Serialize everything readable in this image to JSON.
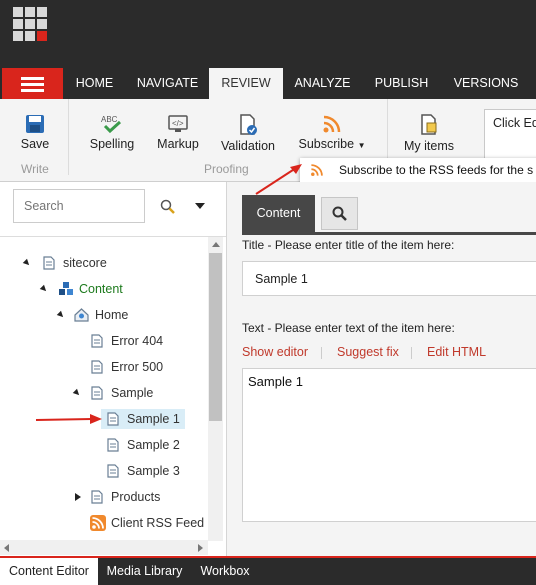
{
  "colors": {
    "accent_red": "#d9251c",
    "dark_bar": "#2b2b2b",
    "link_red": "#c0392b",
    "selected_bg": "#d9edf7"
  },
  "menu_icon": "hamburger-icon",
  "ribbon_tabs": [
    {
      "label": "HOME"
    },
    {
      "label": "NAVIGATE"
    },
    {
      "label": "REVIEW",
      "active": true
    },
    {
      "label": "ANALYZE"
    },
    {
      "label": "PUBLISH"
    },
    {
      "label": "VERSIONS"
    }
  ],
  "ribbon": {
    "write_group": {
      "save": "Save",
      "label": "Write"
    },
    "proofing_group": {
      "spelling": "Spelling",
      "markup": "Markup",
      "validation": "Validation",
      "subscribe": "Subscribe",
      "label": "Proofing"
    },
    "my_items": "My items",
    "click_box_text": "Click Ed"
  },
  "tooltip": {
    "text": "Subscribe to the RSS feeds for the s",
    "icon": "rss-icon"
  },
  "search": {
    "placeholder": "Search"
  },
  "tree": {
    "sitecore": "sitecore",
    "content": "Content",
    "home": "Home",
    "error404": "Error 404",
    "error500": "Error 500",
    "sample": "Sample",
    "sample1": "Sample 1",
    "sample2": "Sample 2",
    "sample3": "Sample 3",
    "products": "Products",
    "rss": "Client RSS Feed",
    "selected": "Sample 1"
  },
  "editor": {
    "content_tab": "Content",
    "title_label": "Title - Please enter title of the item here:",
    "title_value": "Sample 1",
    "text_label": "Text - Please enter text of the item here:",
    "links": {
      "show_editor": "Show editor",
      "suggest_fix": "Suggest fix",
      "edit_html": "Edit HTML"
    },
    "text_value": "Sample 1"
  },
  "bottom_tabs": [
    {
      "label": "Content Editor",
      "active": true
    },
    {
      "label": "Media Library"
    },
    {
      "label": "Workbox"
    }
  ]
}
